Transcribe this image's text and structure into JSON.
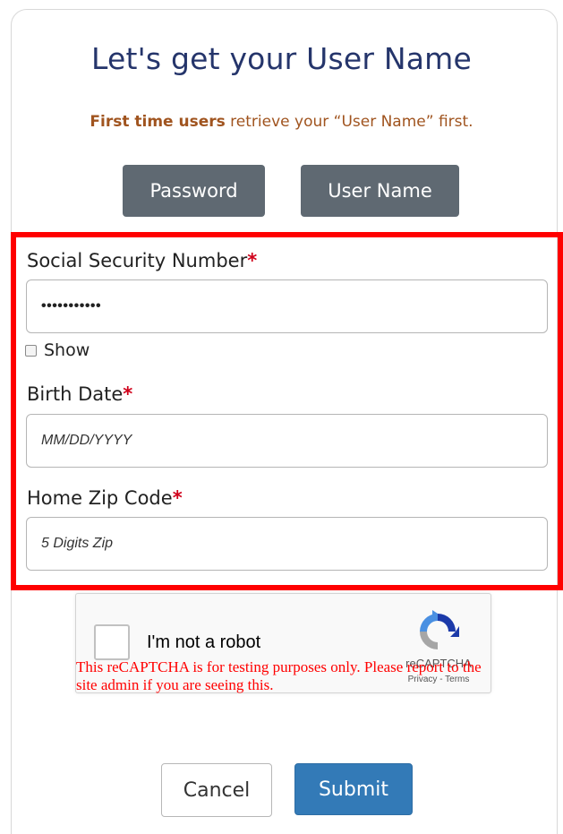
{
  "header": {
    "title": "Let's get your User Name",
    "subtitle_bold": "First time users",
    "subtitle_rest": " retrieve your “User Name” first."
  },
  "tabs": {
    "password_label": "Password",
    "username_label": "User Name"
  },
  "form": {
    "ssn": {
      "label": "Social Security Number",
      "required_mark": "*",
      "value": "•••••••••••"
    },
    "show": {
      "label": "Show",
      "checked": false
    },
    "birth_date": {
      "label": "Birth Date",
      "required_mark": "*",
      "placeholder": "MM/DD/YYYY"
    },
    "zip": {
      "label": "Home Zip Code",
      "required_mark": "*",
      "placeholder": "5 Digits Zip"
    }
  },
  "recaptcha": {
    "checkbox_label": "I'm not a robot",
    "brand": "reCAPTCHA",
    "links": "Privacy - Terms",
    "warning": "This reCAPTCHA is for testing purposes only. Please report to the site admin if you are seeing this."
  },
  "actions": {
    "cancel_label": "Cancel",
    "submit_label": "Submit"
  },
  "colors": {
    "title": "#25356b",
    "subtitle": "#a0541f",
    "tab_button_bg": "#5f6972",
    "highlight_border": "#ff0000",
    "required": "#d0021b",
    "submit_bg": "#337ab7",
    "warning_text": "#ff0000"
  },
  "icons": {
    "recaptcha_logo": "recaptcha-logo-icon"
  }
}
